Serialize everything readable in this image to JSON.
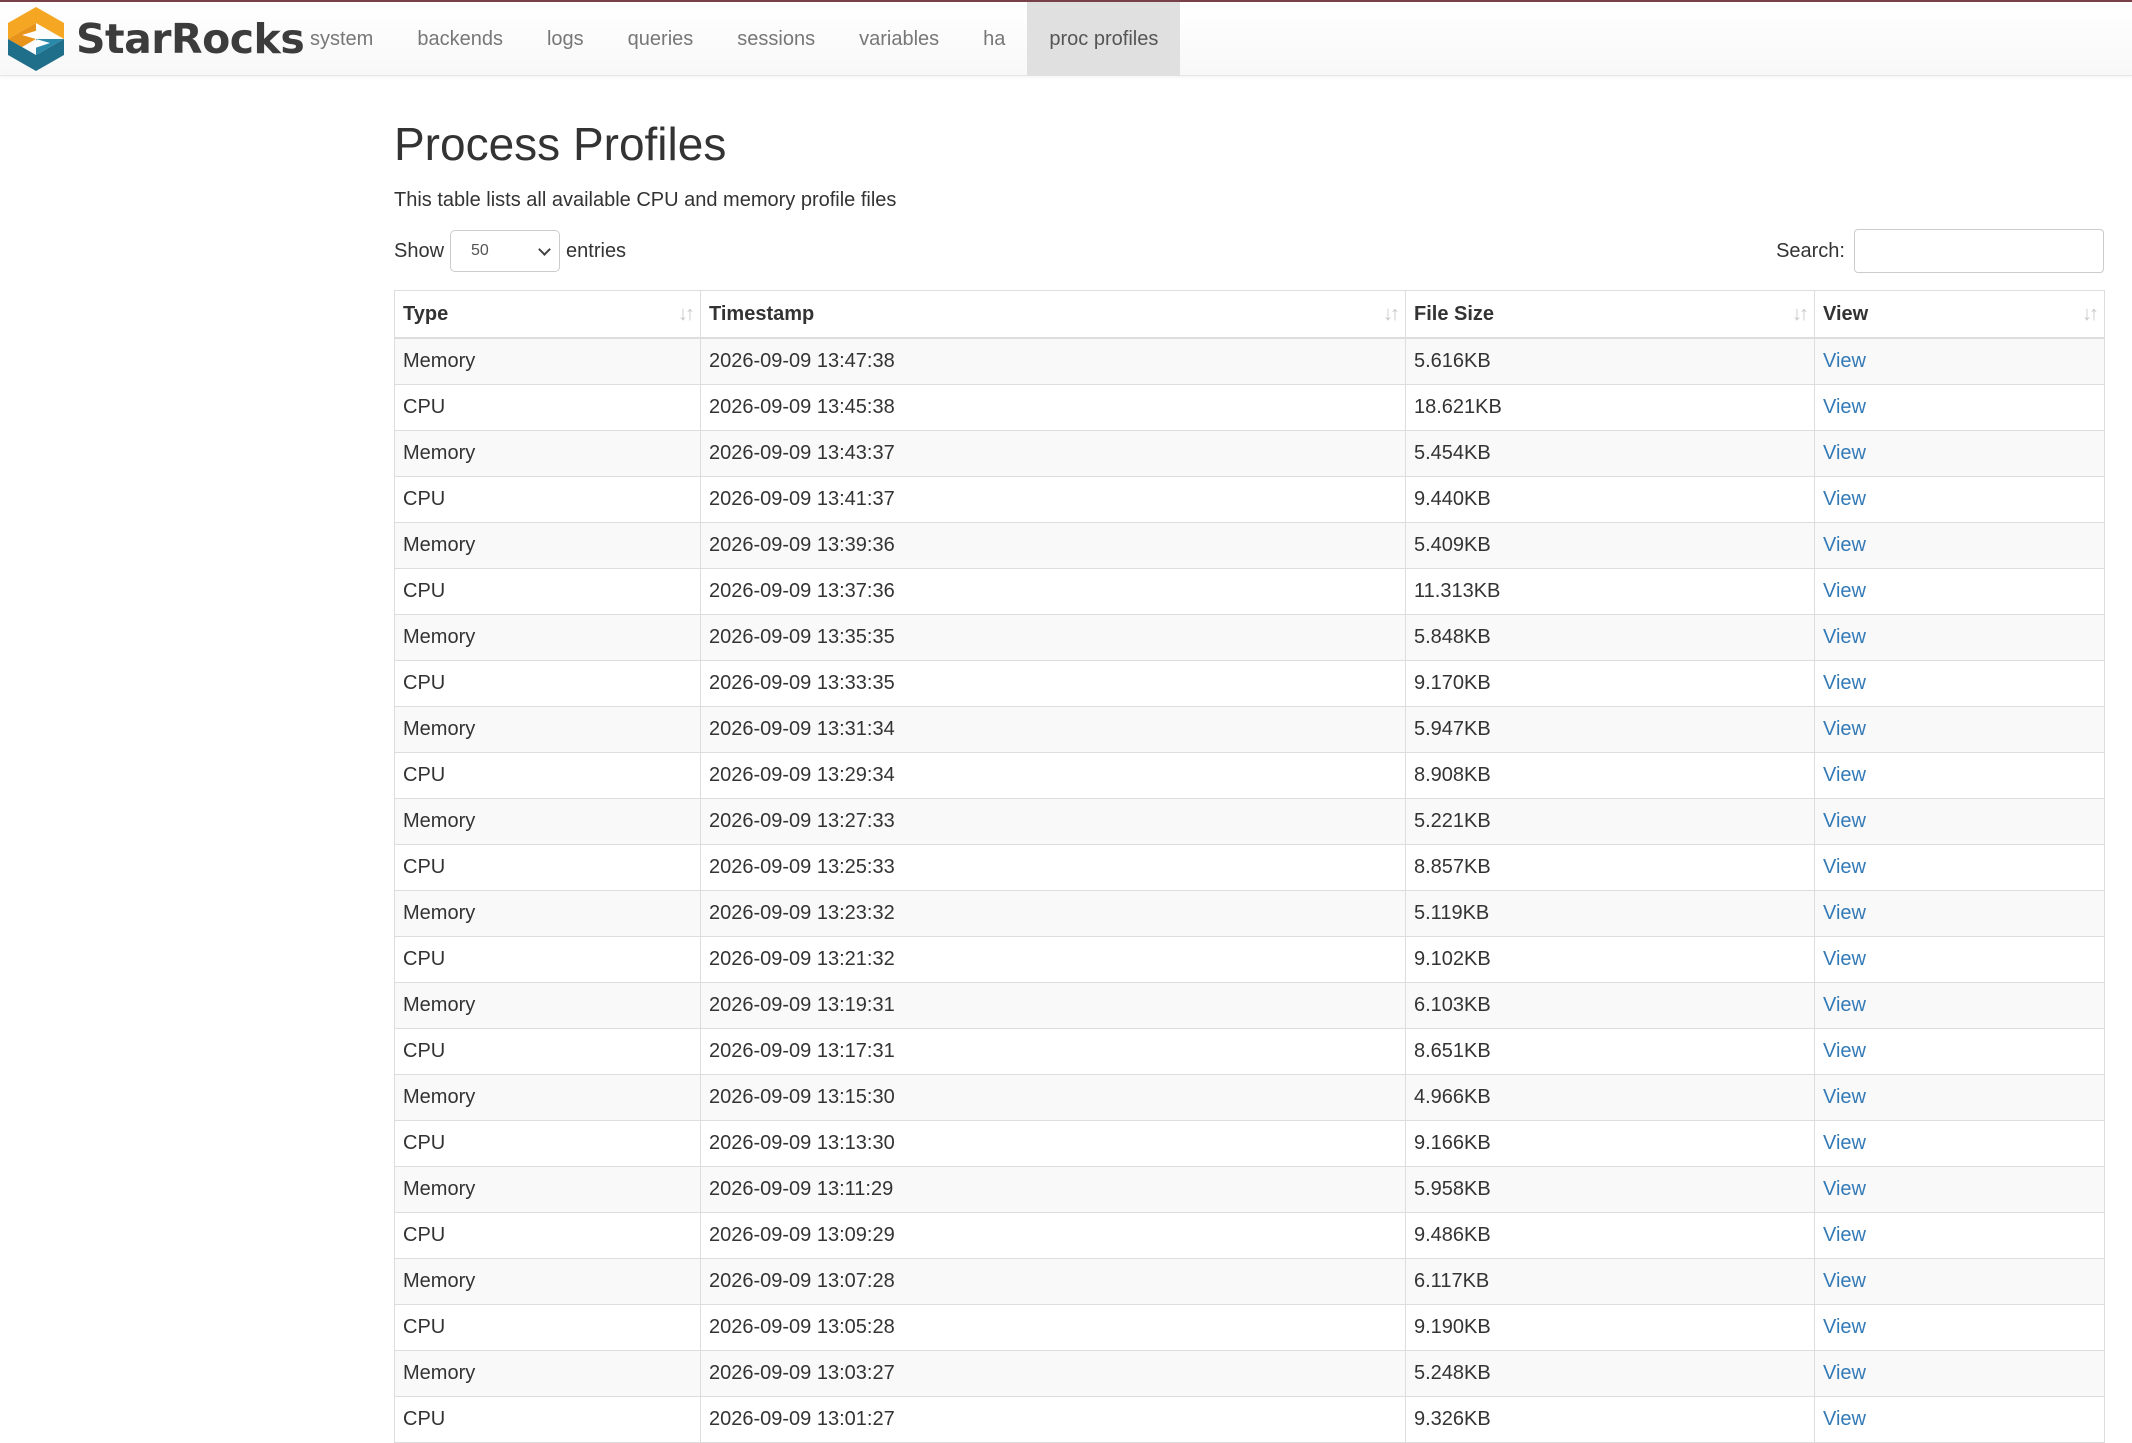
{
  "app": {
    "brand": "StarRocks",
    "nav": [
      {
        "label": "system",
        "active": false
      },
      {
        "label": "backends",
        "active": false
      },
      {
        "label": "logs",
        "active": false
      },
      {
        "label": "queries",
        "active": false
      },
      {
        "label": "sessions",
        "active": false
      },
      {
        "label": "variables",
        "active": false
      },
      {
        "label": "ha",
        "active": false
      },
      {
        "label": "proc profiles",
        "active": true
      }
    ]
  },
  "page": {
    "title": "Process Profiles",
    "subtitle": "This table lists all available CPU and memory profile files"
  },
  "controls": {
    "show_label": "Show",
    "page_size": "50",
    "entries_label": "entries",
    "search_label": "Search:",
    "search_value": ""
  },
  "table": {
    "columns": [
      "Type",
      "Timestamp",
      "File Size",
      "View"
    ],
    "rows": [
      {
        "type": "Memory",
        "timestamp": "2026-09-09 13:47:38",
        "size": "5.616KB",
        "view": "View"
      },
      {
        "type": "CPU",
        "timestamp": "2026-09-09 13:45:38",
        "size": "18.621KB",
        "view": "View"
      },
      {
        "type": "Memory",
        "timestamp": "2026-09-09 13:43:37",
        "size": "5.454KB",
        "view": "View"
      },
      {
        "type": "CPU",
        "timestamp": "2026-09-09 13:41:37",
        "size": "9.440KB",
        "view": "View"
      },
      {
        "type": "Memory",
        "timestamp": "2026-09-09 13:39:36",
        "size": "5.409KB",
        "view": "View"
      },
      {
        "type": "CPU",
        "timestamp": "2026-09-09 13:37:36",
        "size": "11.313KB",
        "view": "View"
      },
      {
        "type": "Memory",
        "timestamp": "2026-09-09 13:35:35",
        "size": "5.848KB",
        "view": "View"
      },
      {
        "type": "CPU",
        "timestamp": "2026-09-09 13:33:35",
        "size": "9.170KB",
        "view": "View"
      },
      {
        "type": "Memory",
        "timestamp": "2026-09-09 13:31:34",
        "size": "5.947KB",
        "view": "View"
      },
      {
        "type": "CPU",
        "timestamp": "2026-09-09 13:29:34",
        "size": "8.908KB",
        "view": "View"
      },
      {
        "type": "Memory",
        "timestamp": "2026-09-09 13:27:33",
        "size": "5.221KB",
        "view": "View"
      },
      {
        "type": "CPU",
        "timestamp": "2026-09-09 13:25:33",
        "size": "8.857KB",
        "view": "View"
      },
      {
        "type": "Memory",
        "timestamp": "2026-09-09 13:23:32",
        "size": "5.119KB",
        "view": "View"
      },
      {
        "type": "CPU",
        "timestamp": "2026-09-09 13:21:32",
        "size": "9.102KB",
        "view": "View"
      },
      {
        "type": "Memory",
        "timestamp": "2026-09-09 13:19:31",
        "size": "6.103KB",
        "view": "View"
      },
      {
        "type": "CPU",
        "timestamp": "2026-09-09 13:17:31",
        "size": "8.651KB",
        "view": "View"
      },
      {
        "type": "Memory",
        "timestamp": "2026-09-09 13:15:30",
        "size": "4.966KB",
        "view": "View"
      },
      {
        "type": "CPU",
        "timestamp": "2026-09-09 13:13:30",
        "size": "9.166KB",
        "view": "View"
      },
      {
        "type": "Memory",
        "timestamp": "2026-09-09 13:11:29",
        "size": "5.958KB",
        "view": "View"
      },
      {
        "type": "CPU",
        "timestamp": "2026-09-09 13:09:29",
        "size": "9.486KB",
        "view": "View"
      },
      {
        "type": "Memory",
        "timestamp": "2026-09-09 13:07:28",
        "size": "6.117KB",
        "view": "View"
      },
      {
        "type": "CPU",
        "timestamp": "2026-09-09 13:05:28",
        "size": "9.190KB",
        "view": "View"
      },
      {
        "type": "Memory",
        "timestamp": "2026-09-09 13:03:27",
        "size": "5.248KB",
        "view": "View"
      },
      {
        "type": "CPU",
        "timestamp": "2026-09-09 13:01:27",
        "size": "9.326KB",
        "view": "View"
      }
    ]
  },
  "icons": {
    "logo": "starrocks-logo-icon",
    "sort": "sort-both-icon",
    "select": "chevron-down-icon"
  },
  "colors": {
    "link": "#337ab7",
    "active_nav_bg": "#e0e0e0",
    "logo_orange": "#f5a623",
    "logo_teal": "#1f6f8b"
  }
}
